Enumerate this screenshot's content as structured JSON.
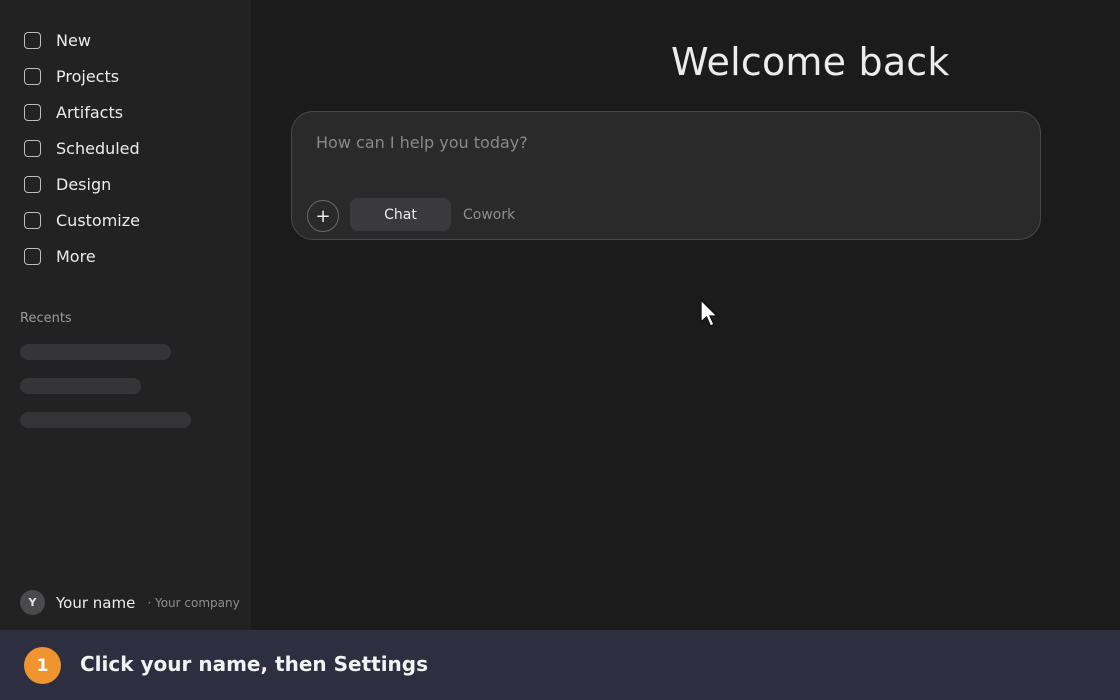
{
  "sidebar": {
    "items": [
      {
        "label": "New",
        "icon": "square-icon"
      },
      {
        "label": "Projects",
        "icon": "square-icon"
      },
      {
        "label": "Artifacts",
        "icon": "square-icon"
      },
      {
        "label": "Scheduled",
        "icon": "square-icon"
      },
      {
        "label": "Design",
        "icon": "square-icon"
      },
      {
        "label": "Customize",
        "icon": "square-icon"
      },
      {
        "label": "More",
        "icon": "square-icon"
      }
    ],
    "recents_label": "Recents"
  },
  "user": {
    "avatar_initial": "Y",
    "name": "Your name",
    "company": "· Your company"
  },
  "main": {
    "greeting": "Welcome back",
    "composer": {
      "placeholder": "How can I help you today?",
      "plus_label": "+",
      "modes": {
        "chat": "Chat",
        "cowork": "Cowork"
      }
    }
  },
  "tip": {
    "step": "1",
    "text": "Click your name, then Settings"
  },
  "colors": {
    "accent": "#f0952e",
    "tip_bar": "#2d2f40",
    "sidebar_bg": "#222223",
    "main_bg": "#1b1b1c"
  }
}
